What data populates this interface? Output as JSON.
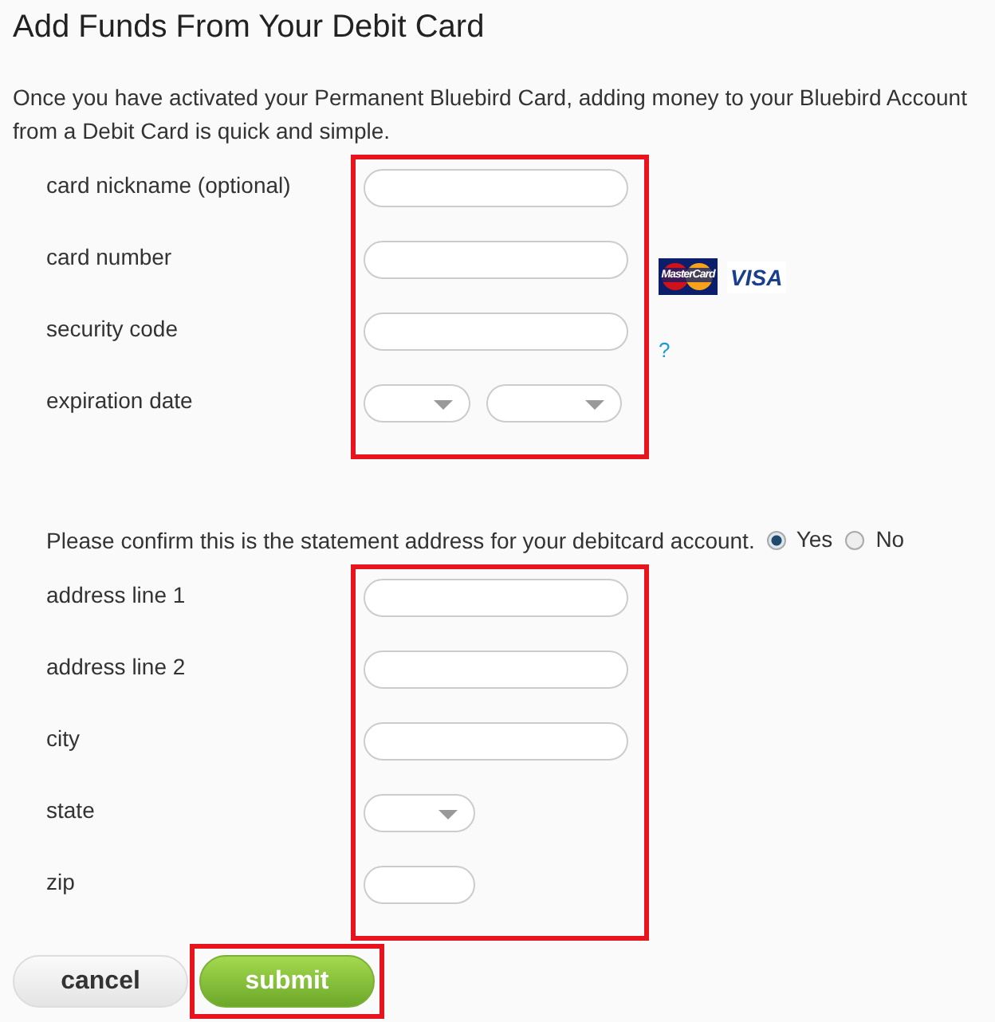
{
  "title": "Add Funds From Your Debit Card",
  "intro": "Once you have activated your Permanent Bluebird Card, adding money to your Bluebird Account from a Debit Card is quick and simple.",
  "card_fields": [
    {
      "label": "card nickname (optional)",
      "kind": "text"
    },
    {
      "label": "card number",
      "kind": "text",
      "logos": [
        "MasterCard",
        "VISA"
      ]
    },
    {
      "label": "security code",
      "kind": "text",
      "help": "?"
    },
    {
      "label": "expiration date",
      "kind": "select-pair"
    }
  ],
  "confirm": {
    "text": "Please confirm this is the statement address for your debitcard account.",
    "options": [
      {
        "label": "Yes",
        "selected": true
      },
      {
        "label": "No",
        "selected": false
      }
    ]
  },
  "address_fields": [
    {
      "label": "address line 1",
      "kind": "text"
    },
    {
      "label": "address line 2",
      "kind": "text"
    },
    {
      "label": "city",
      "kind": "text"
    },
    {
      "label": "state",
      "kind": "select"
    },
    {
      "label": "zip",
      "kind": "short"
    }
  ],
  "buttons": [
    {
      "label": "cancel",
      "kind": "secondary"
    },
    {
      "label": "submit",
      "kind": "primary",
      "highlighted": true
    }
  ]
}
